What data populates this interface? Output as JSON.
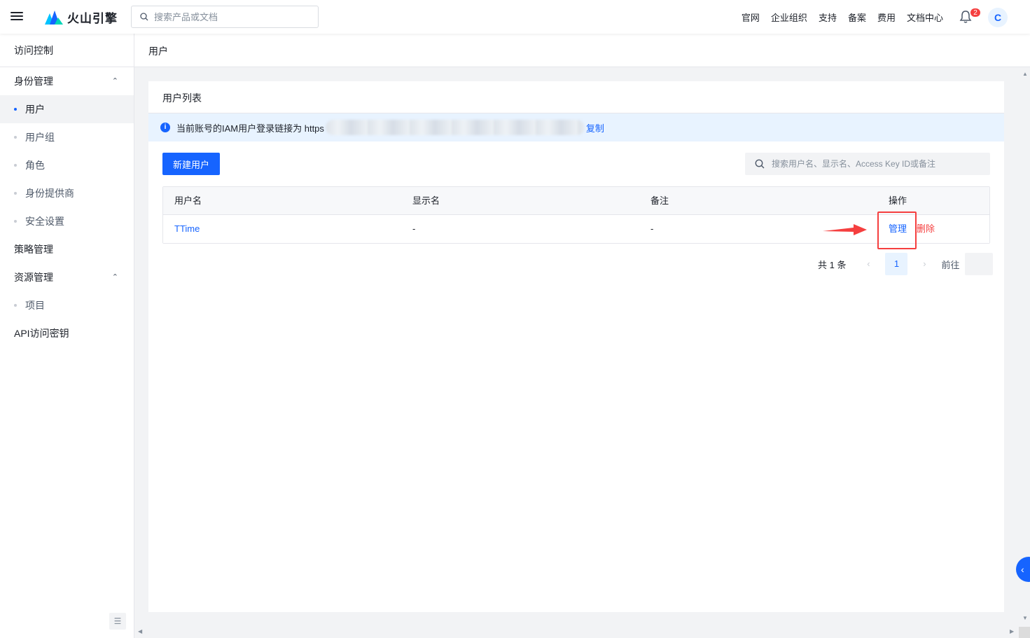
{
  "topbar": {
    "brand": "火山引擎",
    "search_placeholder": "搜索产品或文档",
    "nav": [
      "官网",
      "企业组织",
      "支持",
      "备案",
      "费用",
      "文档中心"
    ],
    "notification_count": "2",
    "avatar_letter": "C"
  },
  "sidebar": {
    "title": "访问控制",
    "groups": [
      {
        "label": "身份管理",
        "expanded": true,
        "items": [
          "用户",
          "用户组",
          "角色",
          "身份提供商",
          "安全设置"
        ]
      },
      {
        "label": "策略管理"
      },
      {
        "label": "资源管理",
        "expanded": true,
        "items": [
          "项目"
        ]
      },
      {
        "label": "API访问密钥"
      }
    ],
    "active_item": "用户"
  },
  "page": {
    "breadcrumb": "用户",
    "card_title": "用户列表",
    "alert": {
      "text": "当前账号的IAM用户登录链接为 https",
      "copy_label": "复制"
    },
    "new_user_button": "新建用户",
    "search_placeholder": "搜索用户名、显示名、Access Key ID或备注",
    "table": {
      "columns": [
        "用户名",
        "显示名",
        "备注",
        "操作"
      ],
      "rows": [
        {
          "username": "TTime",
          "display_name": "-",
          "remark": "-",
          "manage": "管理",
          "delete": "删除"
        }
      ]
    },
    "pagination": {
      "total": "共 1 条",
      "current_page": "1",
      "goto_label": "前往"
    }
  },
  "colors": {
    "primary": "#1664ff",
    "danger": "#f53f3f",
    "alert_bg": "#e8f3ff"
  }
}
